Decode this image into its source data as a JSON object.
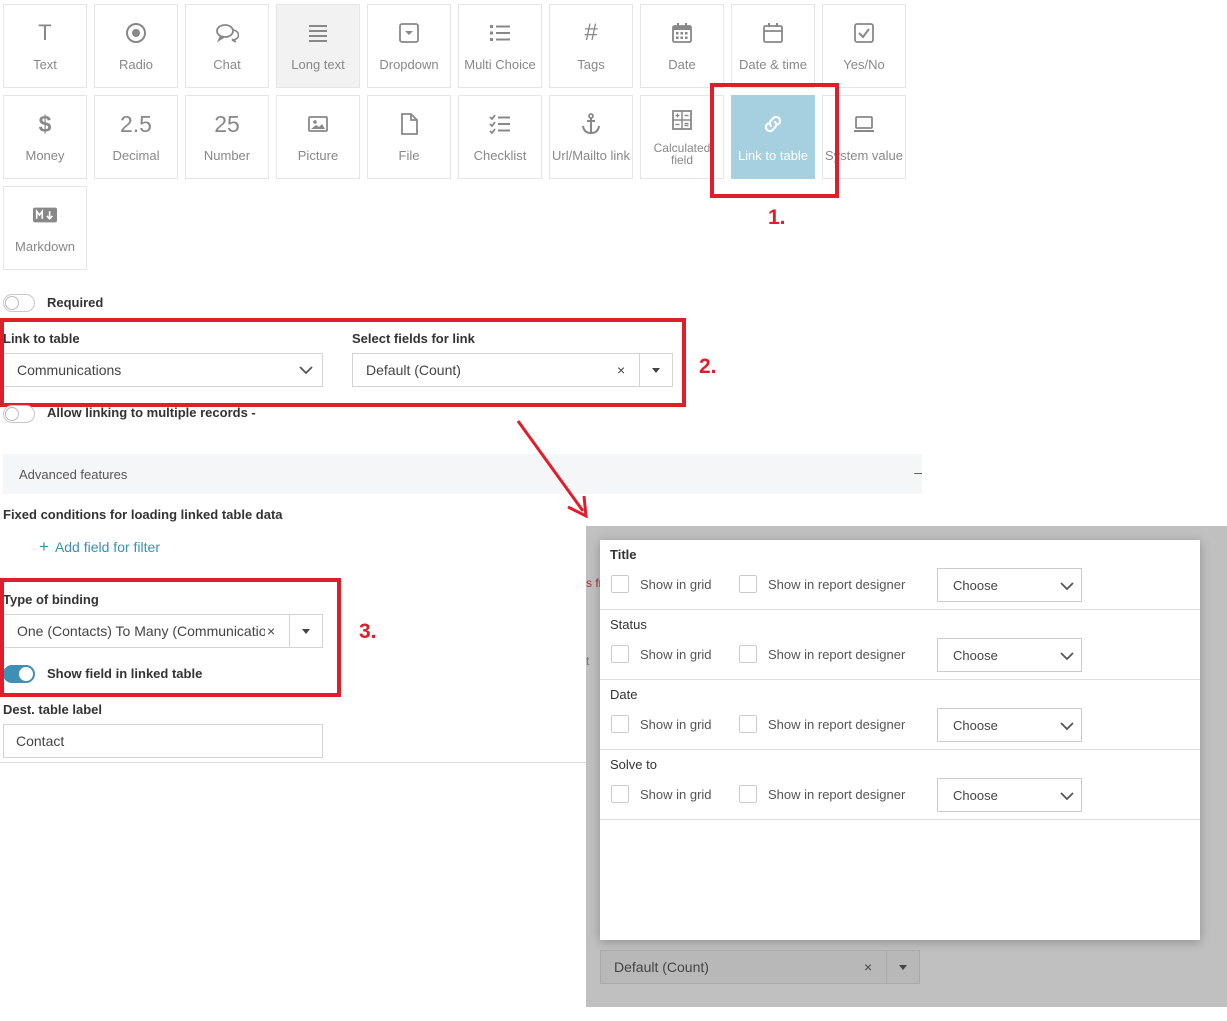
{
  "field_types": [
    {
      "id": "text",
      "label": "Text",
      "icon": "text-t-icon"
    },
    {
      "id": "radio",
      "label": "Radio",
      "icon": "radio-icon"
    },
    {
      "id": "chat",
      "label": "Chat",
      "icon": "chat-bubbles-icon"
    },
    {
      "id": "long-text",
      "label": "Long text",
      "icon": "lines-icon"
    },
    {
      "id": "dropdown",
      "label": "Dropdown",
      "icon": "dropdown-box-icon"
    },
    {
      "id": "multi-choice",
      "label": "Multi Choice",
      "icon": "list-bullets-icon"
    },
    {
      "id": "tags",
      "label": "Tags",
      "icon": "hash-icon"
    },
    {
      "id": "date",
      "label": "Date",
      "icon": "calendar-grid-icon"
    },
    {
      "id": "date-time",
      "label": "Date & time",
      "icon": "calendar-icon"
    },
    {
      "id": "yes-no",
      "label": "Yes/No",
      "icon": "checkbox-icon"
    },
    {
      "id": "money",
      "label": "Money",
      "icon": "dollar-icon",
      "glyph": "$"
    },
    {
      "id": "decimal",
      "label": "Decimal",
      "glyph": "2.5"
    },
    {
      "id": "number",
      "label": "Number",
      "glyph": "25"
    },
    {
      "id": "picture",
      "label": "Picture",
      "icon": "picture-icon"
    },
    {
      "id": "file",
      "label": "File",
      "icon": "file-icon"
    },
    {
      "id": "checklist",
      "label": "Checklist",
      "icon": "checklist-icon"
    },
    {
      "id": "url",
      "label": "Url/Mailto link",
      "icon": "anchor-icon"
    },
    {
      "id": "calculated",
      "label": "Calculated field",
      "icon": "calculator-icon"
    },
    {
      "id": "link-to-table",
      "label": "Link to table",
      "icon": "link-icon"
    },
    {
      "id": "system-value",
      "label": "System value",
      "icon": "laptop-icon"
    },
    {
      "id": "markdown",
      "label": "Markdown",
      "icon": "markdown-icon"
    }
  ],
  "annotations": {
    "step1": "1.",
    "step2": "2.",
    "step3": "3."
  },
  "form": {
    "required_label": "Required",
    "link_to_table_label": "Link to table",
    "link_to_table_value": "Communications",
    "select_fields_label": "Select fields for link",
    "select_fields_value": "Default (Count)",
    "allow_multiple_label": "Allow linking to multiple records -",
    "advanced_label": "Advanced features",
    "advanced_toggle": "–",
    "fixed_conditions_label": "Fixed conditions for loading linked table data",
    "add_filter_label": "Add field for filter",
    "type_of_binding_label": "Type of binding",
    "type_of_binding_value": "One (Contacts) To Many (Communications)",
    "show_field_label": "Show field in linked table",
    "dest_label": "Dest. table label",
    "dest_value": "Contact",
    "clear_symbol": "×",
    "plus_symbol": "+"
  },
  "overlay": {
    "groups": [
      {
        "title": "Title",
        "bold": true
      },
      {
        "title": "Status",
        "bold": false
      },
      {
        "title": "Date",
        "bold": false
      },
      {
        "title": "Solve to",
        "bold": false
      }
    ],
    "show_in_grid": "Show in grid",
    "show_in_report": "Show in report designer",
    "choose": "Choose",
    "bottom_select_value": "Default (Count)",
    "peek_fr": "s fr",
    "peek_t": "t"
  },
  "colors": {
    "accent": "#3d8fb5",
    "selected_tile": "#a6cfe0",
    "annotation_red": "#e01e2b"
  }
}
